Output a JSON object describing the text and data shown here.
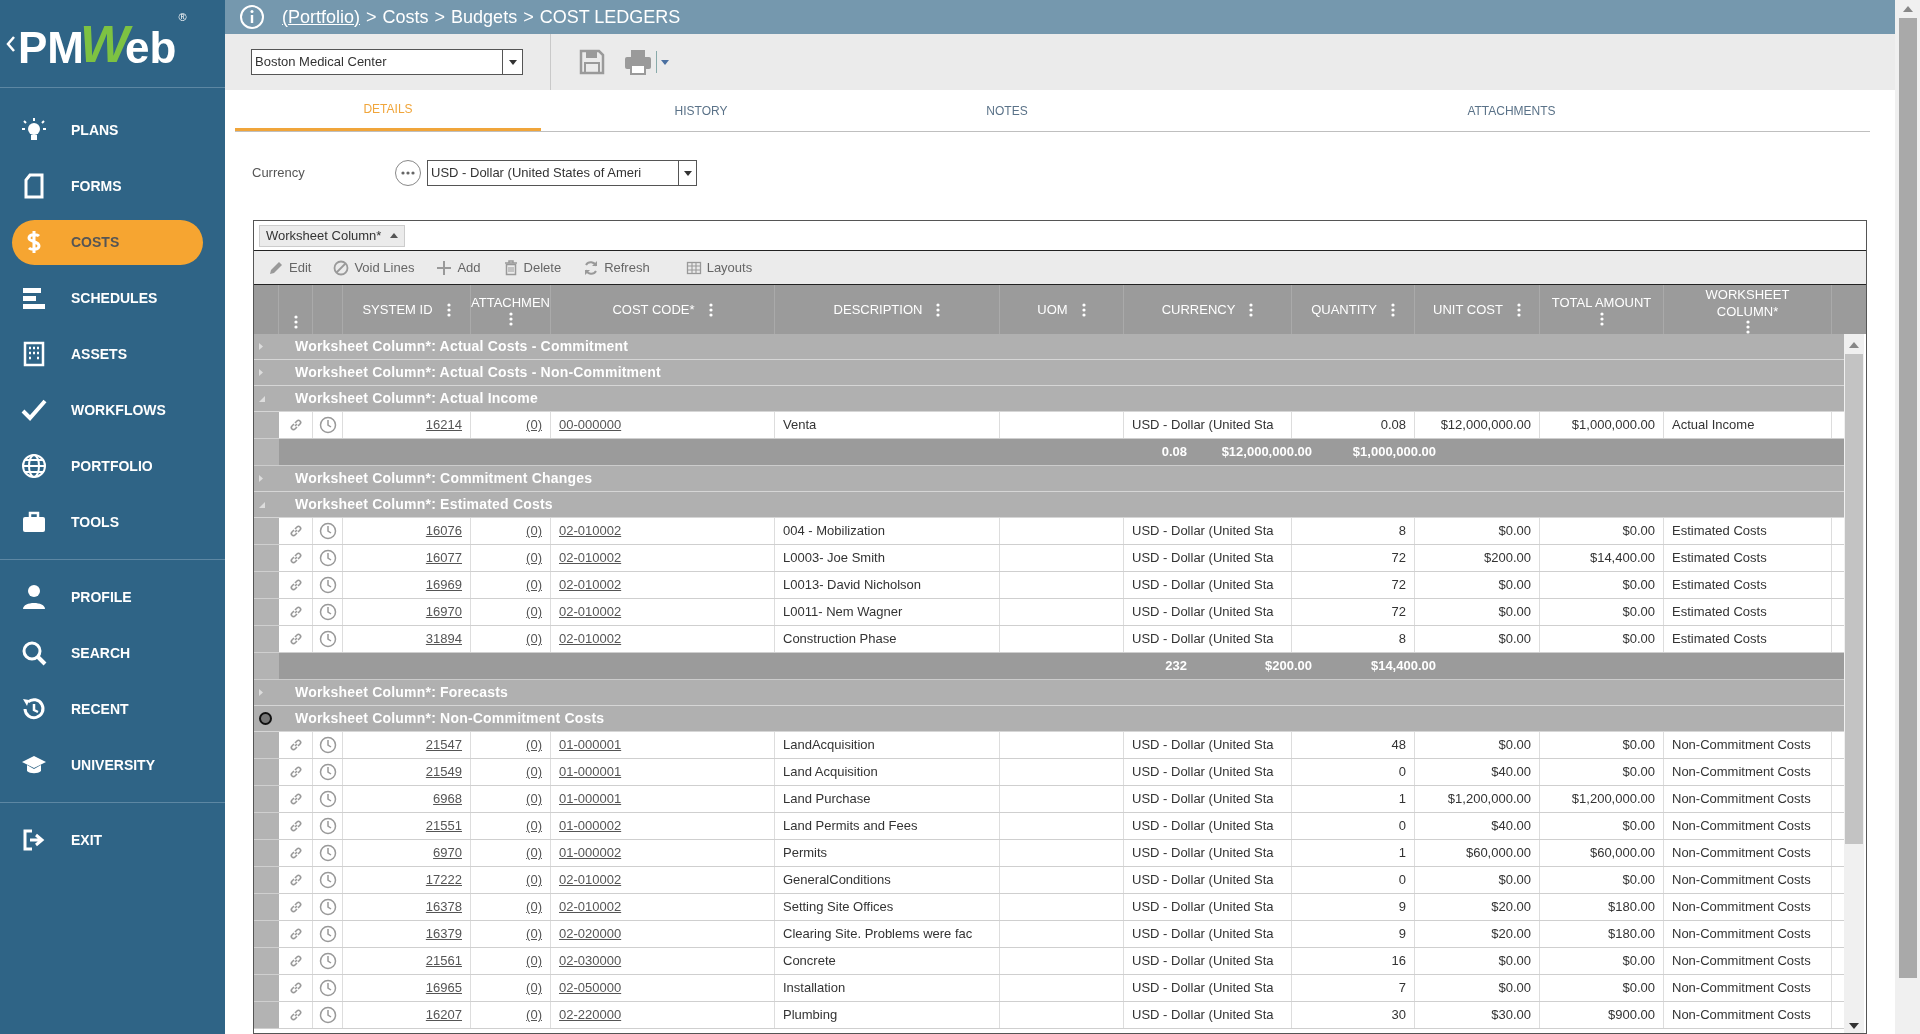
{
  "logo": {
    "prefix": "PM",
    "highlight": "W",
    "suffix": "eb",
    "mark": "®"
  },
  "sidebar": {
    "sections": [
      [
        {
          "label": "PLANS",
          "selected": false
        },
        {
          "label": "FORMS",
          "selected": false
        },
        {
          "label": "COSTS",
          "selected": true
        },
        {
          "label": "SCHEDULES",
          "selected": false
        },
        {
          "label": "ASSETS",
          "selected": false
        },
        {
          "label": "WORKFLOWS",
          "selected": false
        },
        {
          "label": "PORTFOLIO",
          "selected": false
        },
        {
          "label": "TOOLS",
          "selected": false
        }
      ],
      [
        {
          "label": "PROFILE",
          "selected": false
        },
        {
          "label": "SEARCH",
          "selected": false
        },
        {
          "label": "RECENT",
          "selected": false
        },
        {
          "label": "UNIVERSITY",
          "selected": false
        }
      ],
      [
        {
          "label": "EXIT",
          "selected": false
        }
      ]
    ]
  },
  "breadcrumb": {
    "separator": ">",
    "items": [
      {
        "label": "(Portfolio)",
        "link": true
      },
      {
        "label": "Costs",
        "link": false
      },
      {
        "label": "Budgets",
        "link": false
      },
      {
        "label": "COST LEDGERS",
        "link": false
      }
    ]
  },
  "project_select": {
    "value": "Boston Medical Center"
  },
  "tabs": [
    {
      "label": "DETAILS",
      "selected": true
    },
    {
      "label": "HISTORY",
      "selected": false
    },
    {
      "label": "NOTES",
      "selected": false
    },
    {
      "label": "ATTACHMENTS",
      "selected": false
    }
  ],
  "currency": {
    "label": "Currency",
    "value": "USD - Dollar (United States of Ameri"
  },
  "group_by": {
    "label": "Worksheet Column*"
  },
  "grid_toolbar": [
    "Edit",
    "Void Lines",
    "Add",
    "Delete",
    "Refresh",
    "Layouts"
  ],
  "table": {
    "columns": [
      "SYSTEM ID",
      "ATTACHMEN",
      "COST CODE*",
      "DESCRIPTION",
      "UOM",
      "CURRENCY",
      "QUANTITY",
      "UNIT COST",
      "TOTAL AMOUNT",
      "WORKSHEET COLUMN*"
    ],
    "groups": [
      {
        "label": "Worksheet Column*: Actual Costs - Commitment",
        "expanded": false,
        "pointer": false
      },
      {
        "label": "Worksheet Column*: Actual Costs - Non-Commitment",
        "expanded": false,
        "pointer": false
      },
      {
        "label": "Worksheet Column*: Actual Income",
        "expanded": true,
        "pointer": false,
        "rows": [
          {
            "system_id": "16214",
            "attachments": "(0)",
            "cost_code": "00-000000",
            "description": "Venta",
            "currency": "USD - Dollar (United Sta",
            "quantity": "0.08",
            "unit_cost": "$12,000,000.00",
            "total_amount": "$1,000,000.00",
            "worksheet_column": "Actual Income"
          }
        ],
        "totals": {
          "quantity": "0.08",
          "unit_cost": "$12,000,000.00",
          "total_amount": "$1,000,000.00"
        }
      },
      {
        "label": "Worksheet Column*: Commitment Changes",
        "expanded": false,
        "pointer": false
      },
      {
        "label": "Worksheet Column*: Estimated Costs",
        "expanded": true,
        "pointer": false,
        "rows": [
          {
            "system_id": "16076",
            "attachments": "(0)",
            "cost_code": "02-010002",
            "description": "004 - Mobilization",
            "currency": "USD - Dollar (United Sta",
            "quantity": "8",
            "unit_cost": "$0.00",
            "total_amount": "$0.00",
            "worksheet_column": "Estimated Costs"
          },
          {
            "system_id": "16077",
            "attachments": "(0)",
            "cost_code": "02-010002",
            "description": "L0003- Joe Smith",
            "currency": "USD - Dollar (United Sta",
            "quantity": "72",
            "unit_cost": "$200.00",
            "total_amount": "$14,400.00",
            "worksheet_column": "Estimated Costs"
          },
          {
            "system_id": "16969",
            "attachments": "(0)",
            "cost_code": "02-010002",
            "description": "L0013- David Nicholson",
            "currency": "USD - Dollar (United Sta",
            "quantity": "72",
            "unit_cost": "$0.00",
            "total_amount": "$0.00",
            "worksheet_column": "Estimated Costs"
          },
          {
            "system_id": "16970",
            "attachments": "(0)",
            "cost_code": "02-010002",
            "description": "L0011- Nem Wagner",
            "currency": "USD - Dollar (United Sta",
            "quantity": "72",
            "unit_cost": "$0.00",
            "total_amount": "$0.00",
            "worksheet_column": "Estimated Costs"
          },
          {
            "system_id": "31894",
            "attachments": "(0)",
            "cost_code": "02-010002",
            "description": "Construction Phase",
            "currency": "USD - Dollar (United Sta",
            "quantity": "8",
            "unit_cost": "$0.00",
            "total_amount": "$0.00",
            "worksheet_column": "Estimated Costs"
          }
        ],
        "totals": {
          "quantity": "232",
          "unit_cost": "$200.00",
          "total_amount": "$14,400.00"
        }
      },
      {
        "label": "Worksheet Column*: Forecasts",
        "expanded": false,
        "pointer": false
      },
      {
        "label": "Worksheet Column*: Non-Commitment Costs",
        "expanded": true,
        "pointer": true,
        "rows": [
          {
            "system_id": "21547",
            "attachments": "(0)",
            "cost_code": "01-000001",
            "description": "LandAcquisition",
            "currency": "USD - Dollar (United Sta",
            "quantity": "48",
            "unit_cost": "$0.00",
            "total_amount": "$0.00",
            "worksheet_column": "Non-Commitment Costs"
          },
          {
            "system_id": "21549",
            "attachments": "(0)",
            "cost_code": "01-000001",
            "description": "Land Acquisition",
            "currency": "USD - Dollar (United Sta",
            "quantity": "0",
            "unit_cost": "$40.00",
            "total_amount": "$0.00",
            "worksheet_column": "Non-Commitment Costs"
          },
          {
            "system_id": "6968",
            "attachments": "(0)",
            "cost_code": "01-000001",
            "description": "Land Purchase",
            "currency": "USD - Dollar (United Sta",
            "quantity": "1",
            "unit_cost": "$1,200,000.00",
            "total_amount": "$1,200,000.00",
            "worksheet_column": "Non-Commitment Costs"
          },
          {
            "system_id": "21551",
            "attachments": "(0)",
            "cost_code": "01-000002",
            "description": "Land Permits and Fees",
            "currency": "USD - Dollar (United Sta",
            "quantity": "0",
            "unit_cost": "$40.00",
            "total_amount": "$0.00",
            "worksheet_column": "Non-Commitment Costs"
          },
          {
            "system_id": "6970",
            "attachments": "(0)",
            "cost_code": "01-000002",
            "description": "Permits",
            "currency": "USD - Dollar (United Sta",
            "quantity": "1",
            "unit_cost": "$60,000.00",
            "total_amount": "$60,000.00",
            "worksheet_column": "Non-Commitment Costs"
          },
          {
            "system_id": "17222",
            "attachments": "(0)",
            "cost_code": "02-010002",
            "description": "GeneralConditions",
            "currency": "USD - Dollar (United Sta",
            "quantity": "0",
            "unit_cost": "$0.00",
            "total_amount": "$0.00",
            "worksheet_column": "Non-Commitment Costs"
          },
          {
            "system_id": "16378",
            "attachments": "(0)",
            "cost_code": "02-010002",
            "description": "Setting Site Offices",
            "currency": "USD - Dollar (United Sta",
            "quantity": "9",
            "unit_cost": "$20.00",
            "total_amount": "$180.00",
            "worksheet_column": "Non-Commitment Costs"
          },
          {
            "system_id": "16379",
            "attachments": "(0)",
            "cost_code": "02-020000",
            "description": "Clearing Site. Problems were fac",
            "currency": "USD - Dollar (United Sta",
            "quantity": "9",
            "unit_cost": "$20.00",
            "total_amount": "$180.00",
            "worksheet_column": "Non-Commitment Costs"
          },
          {
            "system_id": "21561",
            "attachments": "(0)",
            "cost_code": "02-030000",
            "description": "Concrete",
            "currency": "USD - Dollar (United Sta",
            "quantity": "16",
            "unit_cost": "$0.00",
            "total_amount": "$0.00",
            "worksheet_column": "Non-Commitment Costs"
          },
          {
            "system_id": "16965",
            "attachments": "(0)",
            "cost_code": "02-050000",
            "description": "Installation",
            "currency": "USD - Dollar (United Sta",
            "quantity": "7",
            "unit_cost": "$0.00",
            "total_amount": "$0.00",
            "worksheet_column": "Non-Commitment Costs"
          },
          {
            "system_id": "16207",
            "attachments": "(0)",
            "cost_code": "02-220000",
            "description": "Plumbing",
            "currency": "USD - Dollar (United Sta",
            "quantity": "30",
            "unit_cost": "$30.00",
            "total_amount": "$900.00",
            "worksheet_column": "Non-Commitment Costs"
          }
        ]
      }
    ]
  }
}
